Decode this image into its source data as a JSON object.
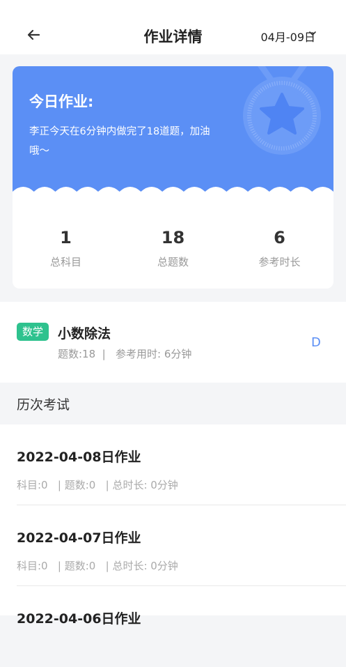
{
  "header": {
    "title": "作业详情",
    "date_selector": "04月-09日"
  },
  "summary": {
    "heading": "今日作业:",
    "description": "李正今天在6分钟内做完了18道题，加油哦～",
    "stats": [
      {
        "value": "1",
        "label": "总科目"
      },
      {
        "value": "18",
        "label": "总题数"
      },
      {
        "value": "6",
        "label": "参考时长"
      }
    ]
  },
  "subject": {
    "badge": "数学",
    "name": "小数除法",
    "meta": "题数:18  |   参考用时: 6分钟",
    "grade": "D"
  },
  "history": {
    "title": "历次考试",
    "items": [
      {
        "title": "2022-04-08日作业",
        "meta": "科目:0   | 题数:0   | 总时长: 0分钟"
      },
      {
        "title": "2022-04-07日作业",
        "meta": "科目:0   | 题数:0   | 总时长: 0分钟"
      },
      {
        "title": "2022-04-06日作业",
        "meta": ""
      }
    ]
  },
  "colors": {
    "accent": "#5b8ff5",
    "badge": "#2ec28e"
  }
}
